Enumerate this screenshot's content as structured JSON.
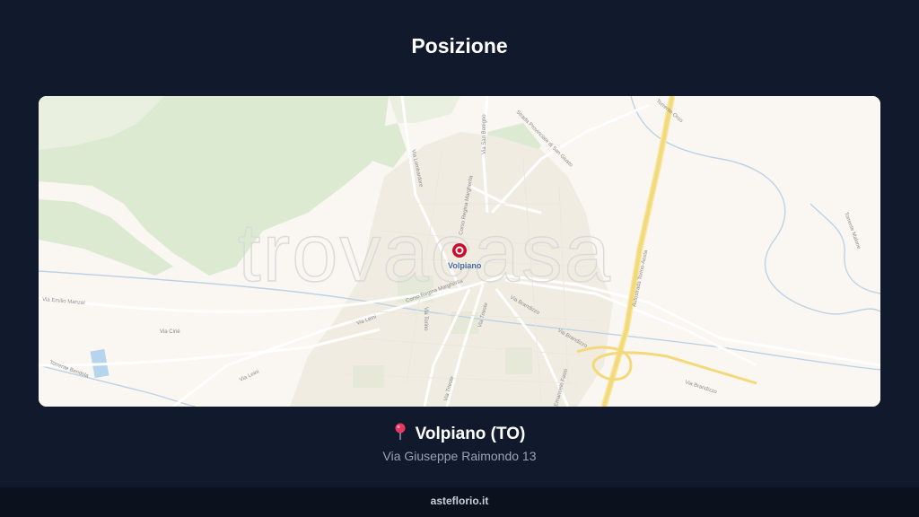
{
  "page": {
    "title": "Posizione"
  },
  "map": {
    "watermark": "trovacasa",
    "place_label": "Volpiano",
    "marker_color": "#c8102e",
    "streets": [
      "Via Lombardore",
      "Via San Benigno",
      "Strada Provinciale di San Giusto",
      "Corso Regina Margherita",
      "Corso Regina Margherita",
      "Via Emilio Manzel",
      "Via Leinì",
      "Via Leinì",
      "Via Cirié",
      "Via Torino",
      "Via Trieste",
      "Via Trieste",
      "Via Brandizzo",
      "Via Brandizzo",
      "Via Brandizzo",
      "Autostrada Torino-Aosta",
      "Torrente Malone",
      "Torrente Bendola",
      "Emanuele Fassi",
      "Torrente Orco"
    ]
  },
  "location": {
    "pin_icon": "round-pushpin-icon",
    "city": "Volpiano (TO)",
    "address": "Via Giuseppe Raimondo 13"
  },
  "footer": {
    "text": "asteflorio.it"
  }
}
